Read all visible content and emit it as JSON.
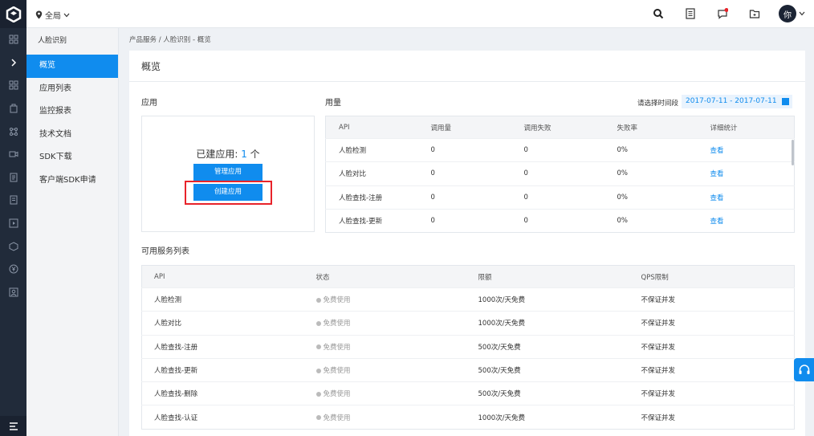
{
  "topbar": {
    "region": "全局",
    "avatar_text": "你"
  },
  "sidebar": {
    "title": "人脸识别",
    "items": [
      {
        "label": "概览"
      },
      {
        "label": "应用列表"
      },
      {
        "label": "监控报表"
      },
      {
        "label": "技术文档"
      },
      {
        "label": "SDK下载"
      },
      {
        "label": "客户端SDK申请"
      }
    ]
  },
  "breadcrumb": "产品服务 / 人脸识别 - 概览",
  "main": {
    "title": "概览",
    "app_section": {
      "title": "应用",
      "count_label": "已建应用:",
      "count": "1",
      "count_unit": "个",
      "manage_button": "管理应用",
      "create_button": "创建应用"
    },
    "usage_section": {
      "title": "用量",
      "date_label": "请选择时间段",
      "date_range": "2017-07-11 - 2017-07-11",
      "columns": [
        "API",
        "调用量",
        "调用失败",
        "失败率",
        "详细统计"
      ],
      "rows": [
        [
          "人脸检测",
          "0",
          "0",
          "0%",
          "查看"
        ],
        [
          "人脸对比",
          "0",
          "0",
          "0%",
          "查看"
        ],
        [
          "人脸查找-注册",
          "0",
          "0",
          "0%",
          "查看"
        ],
        [
          "人脸查找-更新",
          "0",
          "0",
          "0%",
          "查看"
        ]
      ]
    },
    "services_section": {
      "title": "可用服务列表",
      "columns": [
        "API",
        "状态",
        "限额",
        "QPS限制"
      ],
      "rows": [
        [
          "人脸检测",
          "免费使用",
          "1000次/天免费",
          "不保证并发"
        ],
        [
          "人脸对比",
          "免费使用",
          "1000次/天免费",
          "不保证并发"
        ],
        [
          "人脸查找-注册",
          "免费使用",
          "500次/天免费",
          "不保证并发"
        ],
        [
          "人脸查找-更新",
          "免费使用",
          "500次/天免费",
          "不保证并发"
        ],
        [
          "人脸查找-删除",
          "免费使用",
          "500次/天免费",
          "不保证并发"
        ],
        [
          "人脸查找-认证",
          "免费使用",
          "1000次/天免费",
          "不保证并发"
        ]
      ]
    }
  },
  "colors": {
    "accent": "#108cee",
    "rail": "#212b3a",
    "highlight": "#e8232a"
  }
}
